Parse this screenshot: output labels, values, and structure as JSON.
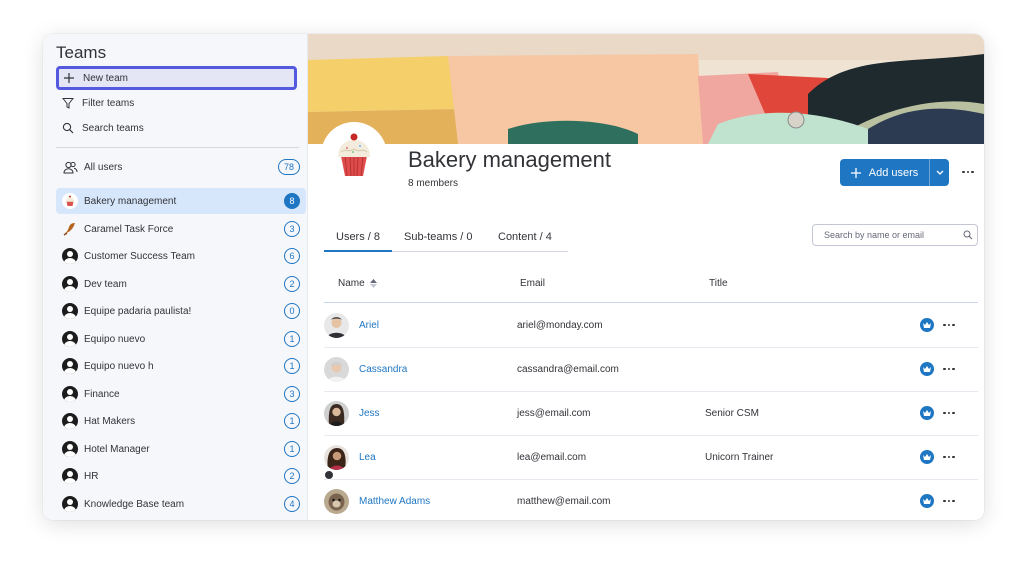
{
  "sidebar": {
    "title": "Teams",
    "actions": {
      "new_team": "New team",
      "filter_teams": "Filter teams",
      "search_teams": "Search teams"
    },
    "all_users": {
      "label": "All users",
      "count": "78"
    },
    "teams": [
      {
        "label": "Bakery management",
        "count": "8",
        "active": true
      },
      {
        "label": "Caramel Task Force",
        "count": "3"
      },
      {
        "label": "Customer Success Team",
        "count": "6"
      },
      {
        "label": "Dev team",
        "count": "2"
      },
      {
        "label": "Equipe padaria paulista!",
        "count": "0"
      },
      {
        "label": "Equipo nuevo",
        "count": "1"
      },
      {
        "label": "Equipo nuevo h",
        "count": "1"
      },
      {
        "label": "Finance",
        "count": "3"
      },
      {
        "label": "Hat Makers",
        "count": "1"
      },
      {
        "label": "Hotel Manager",
        "count": "1"
      },
      {
        "label": "HR",
        "count": "2"
      },
      {
        "label": "Knowledge Base team",
        "count": "4"
      }
    ]
  },
  "team": {
    "name": "Bakery management",
    "members": "8 members",
    "add_users": "Add users"
  },
  "tabs": [
    {
      "label": "Users / 8",
      "active": true
    },
    {
      "label": "Sub-teams / 0"
    },
    {
      "label": "Content / 4"
    }
  ],
  "search": {
    "placeholder": "Search by name or email"
  },
  "table": {
    "columns": {
      "name": "Name",
      "email": "Email",
      "title": "Title"
    },
    "rows": [
      {
        "name": "Ariel",
        "email": "ariel@monday.com",
        "title": ""
      },
      {
        "name": "Cassandra",
        "email": "cassandra@email.com",
        "title": ""
      },
      {
        "name": "Jess",
        "email": "jess@email.com",
        "title": "Senior CSM"
      },
      {
        "name": "Lea",
        "email": "lea@email.com",
        "title": "Unicorn Trainer"
      },
      {
        "name": "Matthew Adams",
        "email": "matthew@email.com",
        "title": ""
      }
    ]
  },
  "colors": {
    "accent": "#1f76c2",
    "highlight_border": "#5559df",
    "active_row": "#d7e7fb",
    "sidebar_bg": "#f6f7fb"
  }
}
